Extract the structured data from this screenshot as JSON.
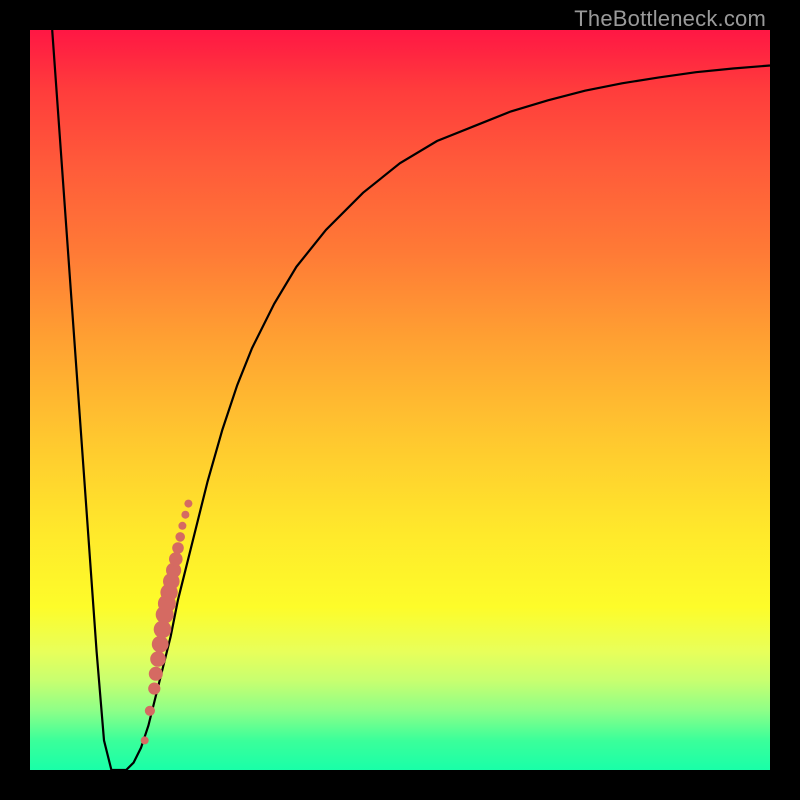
{
  "attribution": "TheBottleneck.com",
  "colors": {
    "curve": "#000000",
    "dots": "#d56a62",
    "gradient_stops": [
      "#ff1744",
      "#ff3c3c",
      "#ff5a3a",
      "#ff7a36",
      "#ffa132",
      "#ffc72f",
      "#ffe92b",
      "#fdfc2a",
      "#e8ff5a",
      "#c7ff70",
      "#8dff88",
      "#3bff9a",
      "#19ffa8"
    ]
  },
  "chart_data": {
    "type": "line",
    "title": "",
    "xlabel": "",
    "ylabel": "",
    "xlim": [
      0,
      100
    ],
    "ylim": [
      0,
      100
    ],
    "grid": false,
    "legend": false,
    "x": [
      3,
      5,
      7,
      9,
      10,
      11,
      12,
      13,
      14,
      15,
      16,
      17,
      18,
      19,
      20,
      22,
      24,
      26,
      28,
      30,
      33,
      36,
      40,
      45,
      50,
      55,
      60,
      65,
      70,
      75,
      80,
      85,
      90,
      95,
      100
    ],
    "values": [
      100,
      72,
      44,
      16,
      4,
      0,
      0,
      0,
      1,
      3,
      6,
      10,
      14,
      18,
      23,
      31,
      39,
      46,
      52,
      57,
      63,
      68,
      73,
      78,
      82,
      85,
      87,
      89,
      90.5,
      91.8,
      92.8,
      93.6,
      94.3,
      94.8,
      95.2
    ],
    "series_name": "bottleneck-curve",
    "dot_series": {
      "name": "highlight-dots",
      "color": "#d56a62",
      "points": [
        {
          "x": 15.5,
          "y": 4
        },
        {
          "x": 16.2,
          "y": 8
        },
        {
          "x": 16.8,
          "y": 11
        },
        {
          "x": 17.0,
          "y": 13
        },
        {
          "x": 17.3,
          "y": 15
        },
        {
          "x": 17.6,
          "y": 17
        },
        {
          "x": 17.9,
          "y": 19
        },
        {
          "x": 18.2,
          "y": 21
        },
        {
          "x": 18.5,
          "y": 22.5
        },
        {
          "x": 18.8,
          "y": 24
        },
        {
          "x": 19.1,
          "y": 25.5
        },
        {
          "x": 19.4,
          "y": 27
        },
        {
          "x": 19.7,
          "y": 28.5
        },
        {
          "x": 20.0,
          "y": 30
        },
        {
          "x": 20.3,
          "y": 31.5
        },
        {
          "x": 20.6,
          "y": 33
        },
        {
          "x": 21.0,
          "y": 34.5
        },
        {
          "x": 21.4,
          "y": 36
        }
      ]
    }
  }
}
